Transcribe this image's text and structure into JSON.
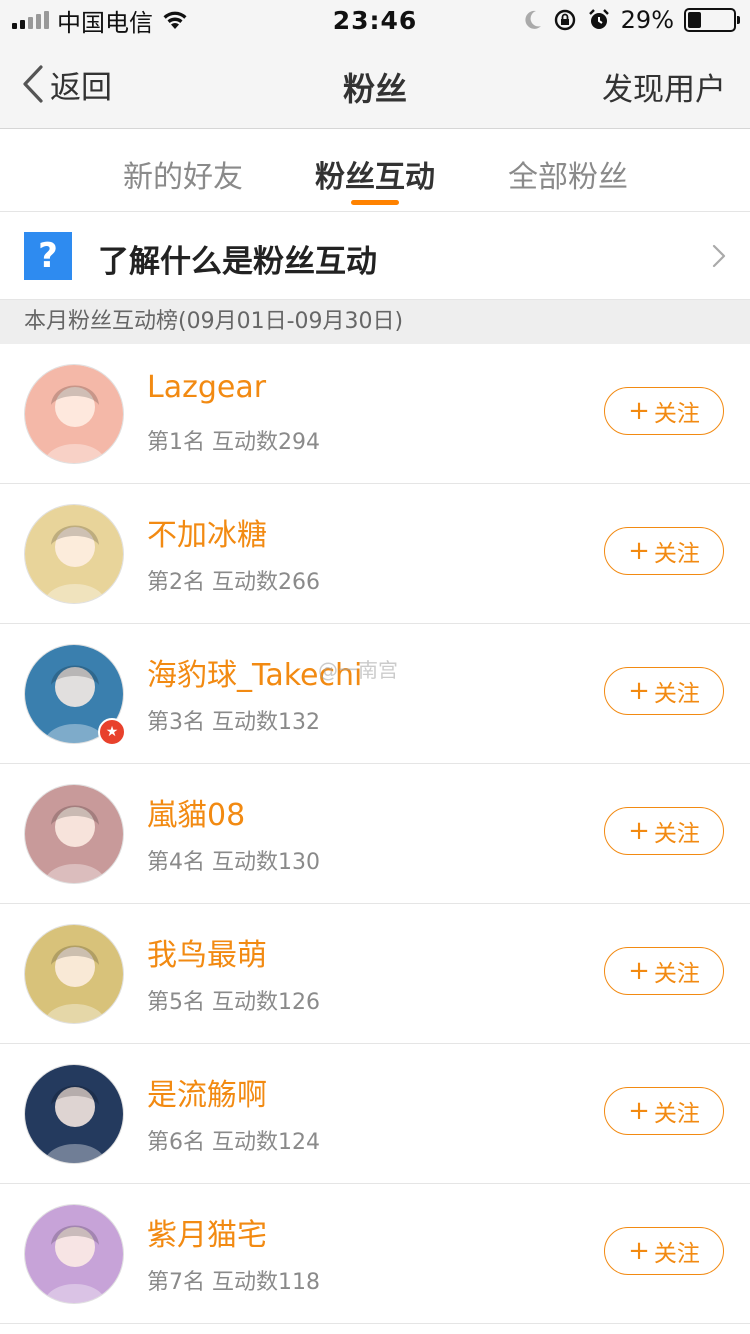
{
  "status_bar": {
    "carrier": "中国电信",
    "time": "23:46",
    "battery_percent": "29%",
    "battery_level": 0.29
  },
  "nav": {
    "back_label": "返回",
    "title": "粉丝",
    "right_label": "发现用户"
  },
  "tabs": [
    {
      "label": "新的好友"
    },
    {
      "label": "粉丝互动"
    },
    {
      "label": "全部粉丝"
    }
  ],
  "active_tab": "粉丝互动",
  "help": {
    "icon_text": "?",
    "text": "了解什么是粉丝互动"
  },
  "section_header": "本月粉丝互动榜(09月01日-09月30日)",
  "follow_label": "关注",
  "follow_plus": "+",
  "fans": [
    {
      "name": "Lazgear",
      "meta": "第1名 互动数294",
      "avatar_color": "#f4b8a8"
    },
    {
      "name": "不加冰糖",
      "meta": "第2名 互动数266",
      "avatar_color": "#e8d49a"
    },
    {
      "name": "海豹球_Takechi",
      "meta": "第3名 互动数132",
      "avatar_color": "#3a7fae",
      "badge": "★"
    },
    {
      "name": "嵐貓08",
      "meta": "第4名 互动数130",
      "avatar_color": "#c89a9a"
    },
    {
      "name": "我鸟最萌",
      "meta": "第5名 互动数126",
      "avatar_color": "#d8c27a"
    },
    {
      "name": "是流觞啊",
      "meta": "第6名 互动数124",
      "avatar_color": "#243a5e"
    },
    {
      "name": "紫月猫宅",
      "meta": "第7名 互动数118",
      "avatar_color": "#c7a3d8"
    }
  ],
  "watermark": "@一南宫",
  "colors": {
    "accent": "#f28a12",
    "tab_indicator": "#ff8200",
    "help_icon": "#2e8bf0",
    "badge": "#e8412c"
  }
}
